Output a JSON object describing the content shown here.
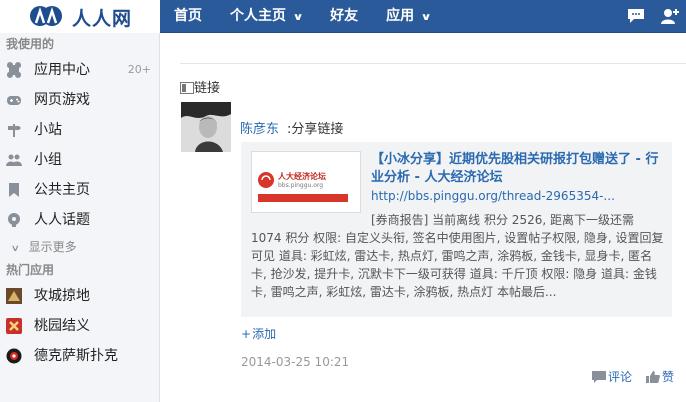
{
  "header": {
    "brand": "人人网",
    "nav": [
      "首页",
      "个人主页",
      "好友",
      "应用"
    ]
  },
  "sidebar": {
    "section_used": "我使用的",
    "items": [
      {
        "label": "应用中心",
        "count": "20+"
      },
      {
        "label": "网页游戏"
      },
      {
        "label": "小站"
      },
      {
        "label": "小组"
      },
      {
        "label": "公共主页"
      },
      {
        "label": "人人话题"
      }
    ],
    "more": "显示更多",
    "section_hot": "热门应用",
    "hot_apps": [
      {
        "label": "攻城掠地"
      },
      {
        "label": "桃园结义"
      },
      {
        "label": "德克萨斯扑克"
      }
    ]
  },
  "feed": {
    "type_label": "链接",
    "author": "陈彦东",
    "action": ":分享链接",
    "share": {
      "title": "【小冰分享】近期优先股相关研报打包赠送了 - 行业分析 - 人大经济论坛",
      "url": "http://bbs.pinggu.org/thread-2965354-...",
      "thumb_text": "人大经济论坛",
      "thumb_sub": "bbs.pinggu.org",
      "body": "[券商报告] 当前离线 积分 2526, 距离下一级还需 1074 积分 权限: 自定义头衔, 签名中使用图片, 设置帖子权限, 隐身, 设置回复可见 道具: 彩虹炫, 雷达卡, 热点灯, 雷鸣之声, 涂鸦板, 金钱卡, 显身卡, 匿名卡, 抢沙发, 提升卡, 沉默卡下一级可获得 道具: 千斤顶 权限: 隐身 道具: 金钱卡, 雷鸣之声, 彩虹炫, 雷达卡, 涂鸦板, 热点灯 本帖最后..."
    },
    "add_label": "添加",
    "timestamp": "2014-03-25 10:21",
    "comment_label": "评论",
    "like_label": "赞"
  },
  "colors": {
    "nav_bg": "#2a5a9a",
    "link": "#2a6ab0",
    "sidebar_bg": "#f3f5f8"
  }
}
